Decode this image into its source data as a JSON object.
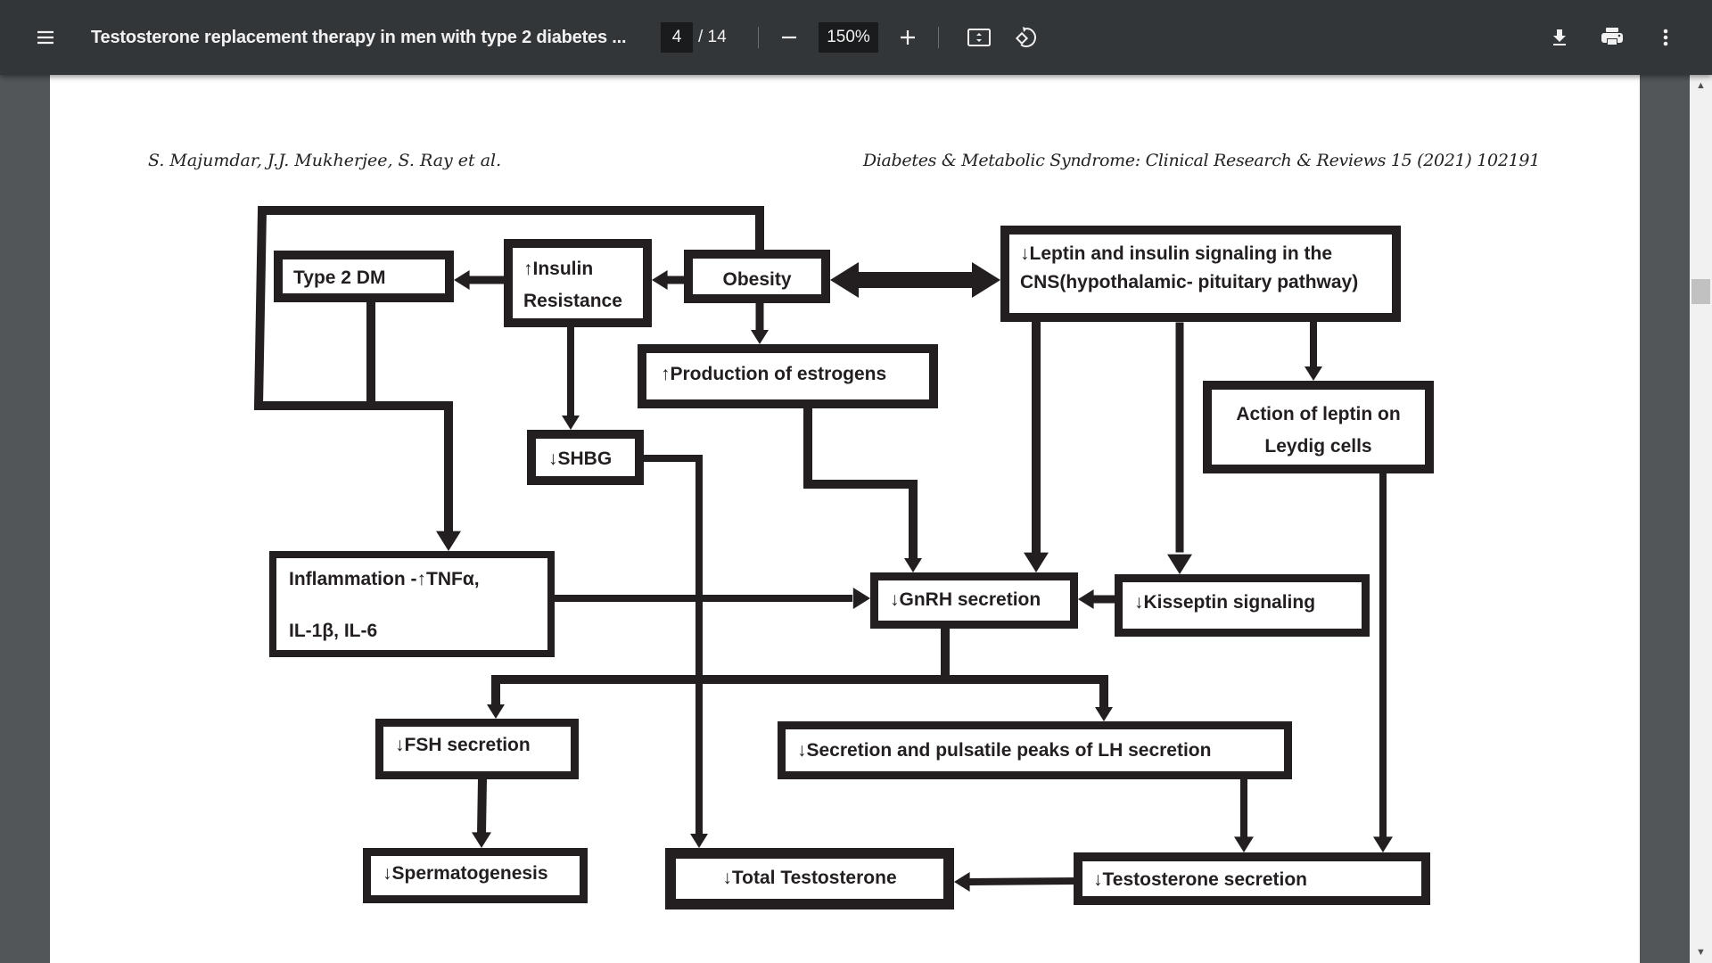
{
  "toolbar": {
    "menu_icon": "hamburger-menu-icon",
    "title": "Testosterone replacement therapy in men with type 2 diabetes ...",
    "current_page": "4",
    "page_total": "/ 14",
    "zoom_out_icon": "minus-icon",
    "zoom_level": "150%",
    "zoom_in_icon": "plus-icon",
    "fit_icon": "fit-to-page-icon",
    "rotate_icon": "rotate-counterclockwise-icon",
    "download_icon": "download-icon",
    "print_icon": "print-icon",
    "more_icon": "more-vertical-icon"
  },
  "document": {
    "running_header_left": "S. Majumdar, J.J. Mukherjee, S. Ray et al.",
    "running_header_right": "Diabetes & Metabolic Syndrome: Clinical Research & Reviews 15 (2021) 102191"
  },
  "diagram": {
    "boxes": {
      "type2dm": [
        "Type 2 DM"
      ],
      "insulin": [
        "↑Insulin",
        "Resistance"
      ],
      "obesity": [
        "Obesity"
      ],
      "leptin_cns": [
        "↓Leptin and insulin signaling in the",
        "CNS(hypothalamic- pituitary pathway)"
      ],
      "estrogens": [
        "↑Production of estrogens"
      ],
      "leydig": [
        "Action of leptin on",
        "Leydig cells"
      ],
      "shbg": [
        "↓SHBG"
      ],
      "inflammation": [
        "Inflammation -↑TNFα,",
        "IL-1β, IL-6"
      ],
      "gnrh": [
        "↓GnRH secretion"
      ],
      "kisspeptin": [
        "↓Kisseptin signaling"
      ],
      "fsh": [
        "↓FSH secretion"
      ],
      "lh": [
        "↓Secretion and pulsatile peaks of LH secretion"
      ],
      "spermatogenesis": [
        "↓Spermatogenesis"
      ],
      "total_testosterone": [
        "↓Total Testosterone"
      ],
      "testosterone_secretion": [
        "↓Testosterone secretion"
      ]
    }
  },
  "scrollbar": {
    "up_arrow": "▲",
    "down_arrow": "▼"
  }
}
